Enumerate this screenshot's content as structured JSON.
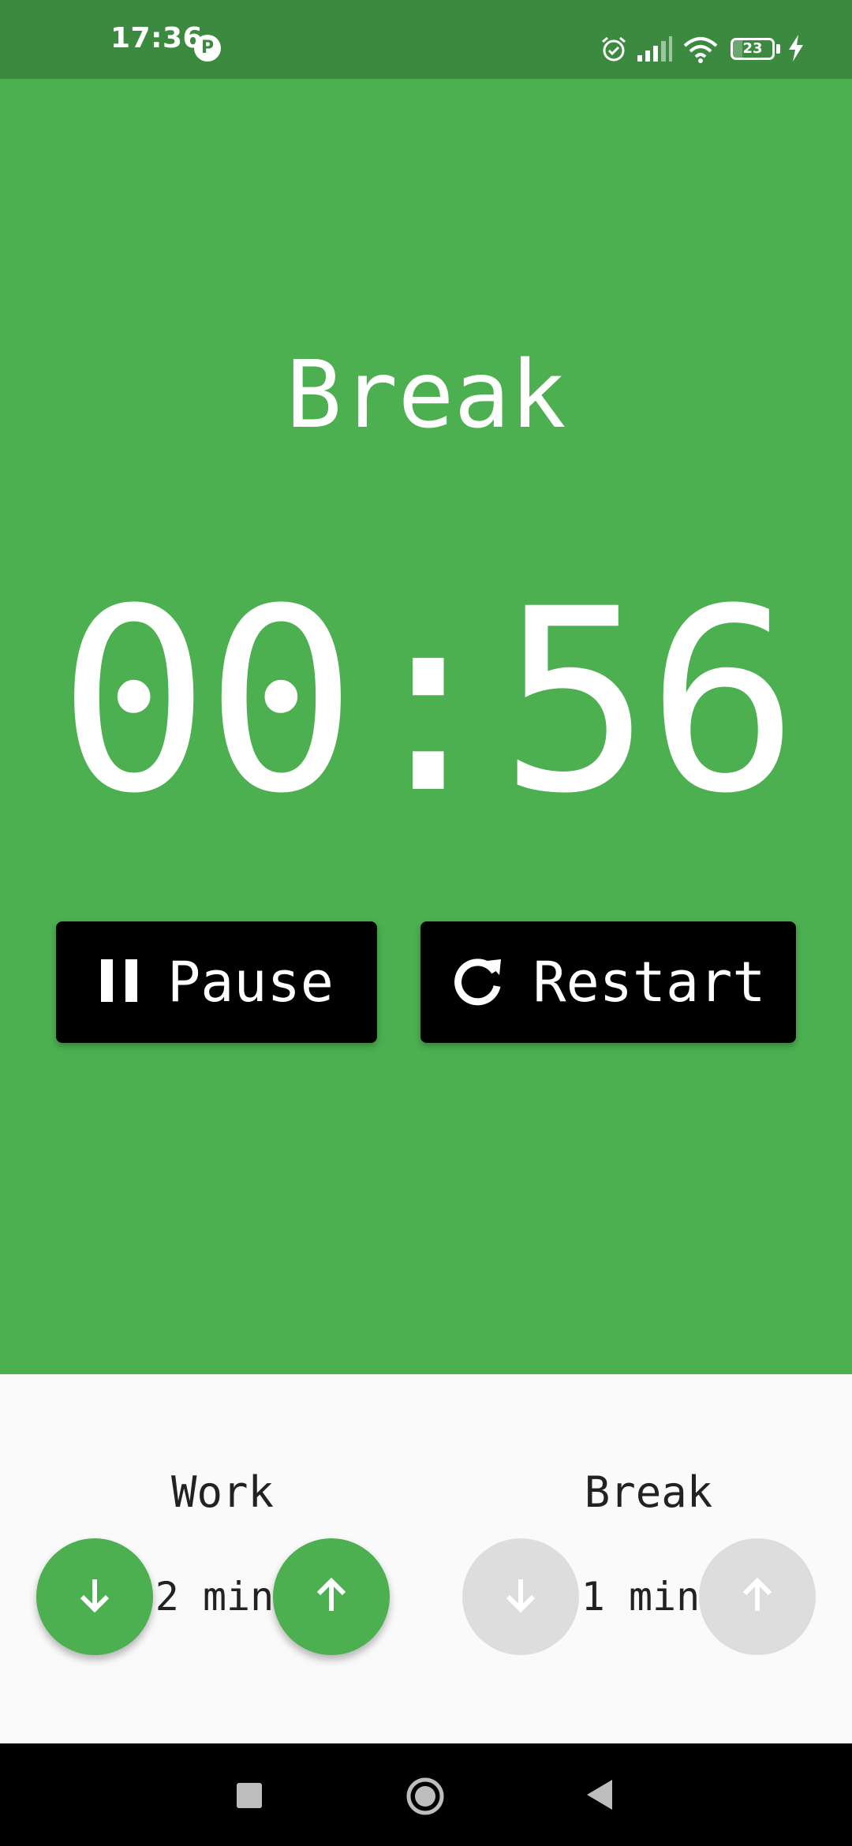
{
  "status_bar": {
    "time": "17:36",
    "app_icon_letter": "P",
    "battery_level": "23",
    "battery_fraction": 0.23,
    "icons": [
      "alarm-icon",
      "signal-icon",
      "wifi-icon",
      "battery-icon",
      "charging-icon"
    ]
  },
  "timer": {
    "mode": "Break",
    "time": "00:56"
  },
  "actions": {
    "pause_label": "Pause",
    "restart_label": "Restart"
  },
  "settings": {
    "work": {
      "label": "Work",
      "value": "2 min",
      "buttons_enabled": true
    },
    "break": {
      "label": "Break",
      "value": "1 min",
      "buttons_enabled": false
    }
  },
  "colors": {
    "primary": "#4caf50",
    "status_bar": "#3c8a40",
    "button_bg": "#000000",
    "panel_bg": "#fafafa",
    "disabled": "#dddddd"
  }
}
